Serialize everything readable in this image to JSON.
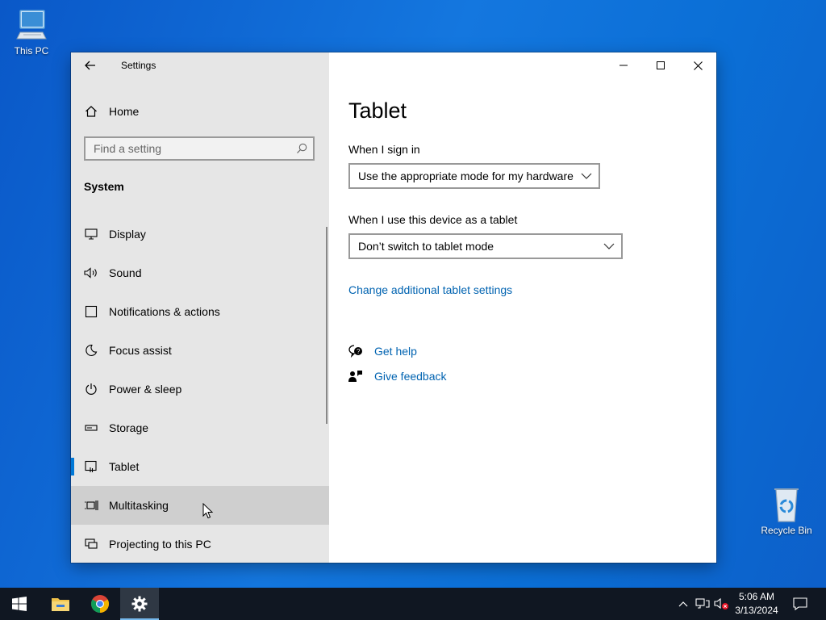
{
  "desktop": {
    "icons": [
      {
        "label": "This PC",
        "icon": "this-pc-icon"
      },
      {
        "label": "Recycle Bin",
        "icon": "recycle-bin-icon"
      }
    ]
  },
  "window": {
    "app_title": "Settings",
    "sidebar": {
      "home_label": "Home",
      "search_placeholder": "Find a setting",
      "section_label": "System",
      "items": [
        {
          "label": "Display",
          "icon": "display-icon"
        },
        {
          "label": "Sound",
          "icon": "sound-icon"
        },
        {
          "label": "Notifications & actions",
          "icon": "notifications-icon"
        },
        {
          "label": "Focus assist",
          "icon": "focus-assist-moon-icon"
        },
        {
          "label": "Power & sleep",
          "icon": "power-icon"
        },
        {
          "label": "Storage",
          "icon": "storage-icon"
        },
        {
          "label": "Tablet",
          "icon": "tablet-icon",
          "selected": true
        },
        {
          "label": "Multitasking",
          "icon": "multitasking-icon",
          "hovered": true
        },
        {
          "label": "Projecting to this PC",
          "icon": "projecting-icon"
        }
      ]
    },
    "content": {
      "page_title": "Tablet",
      "sign_in_label": "When I sign in",
      "sign_in_value": "Use the appropriate mode for my hardware",
      "tablet_use_label": "When I use this device as a tablet",
      "tablet_use_value": "Don’t switch to tablet mode",
      "additional_settings_link": "Change additional tablet settings",
      "get_help_link": "Get help",
      "give_feedback_link": "Give feedback"
    },
    "accent_color": "#0078d7",
    "link_color": "#0063b1"
  },
  "taskbar": {
    "apps": [
      {
        "name": "start",
        "icon": "windows-start-icon"
      },
      {
        "name": "file-explorer",
        "icon": "folder-icon"
      },
      {
        "name": "chrome",
        "icon": "chrome-icon"
      },
      {
        "name": "settings",
        "icon": "gear-icon",
        "active": true
      }
    ],
    "clock": {
      "time": "5:06 AM",
      "date": "3/13/2024"
    }
  }
}
